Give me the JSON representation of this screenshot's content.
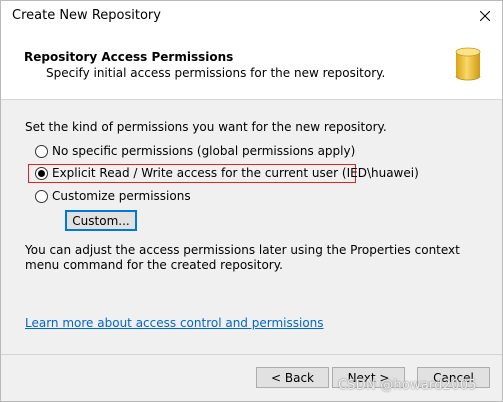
{
  "window": {
    "title": "Create New Repository"
  },
  "header": {
    "title": "Repository Access Permissions",
    "subtitle": "Specify initial access permissions for the new repository.",
    "icon": "database-icon"
  },
  "content": {
    "intro": "Set the kind of permissions you want for the new repository.",
    "options": [
      {
        "label": "No specific permissions (global permissions apply)",
        "checked": false
      },
      {
        "label": "Explicit Read / Write access for the current user (IED\\huawei)",
        "checked": true
      },
      {
        "label": "Customize permissions",
        "checked": false
      }
    ],
    "custom_button": "Custom...",
    "note": "You can adjust the access permissions later using the Properties context menu command for the created repository.",
    "learn_link": "Learn more about access control and permissions"
  },
  "footer": {
    "back": "< Back",
    "next": "Next >",
    "cancel": "Cancel"
  },
  "watermark": "CSDN @howard2005",
  "colors": {
    "highlight": "#e02424",
    "link": "#0066cc",
    "focus": "#0078d7",
    "db_icon": "#f2c230"
  }
}
